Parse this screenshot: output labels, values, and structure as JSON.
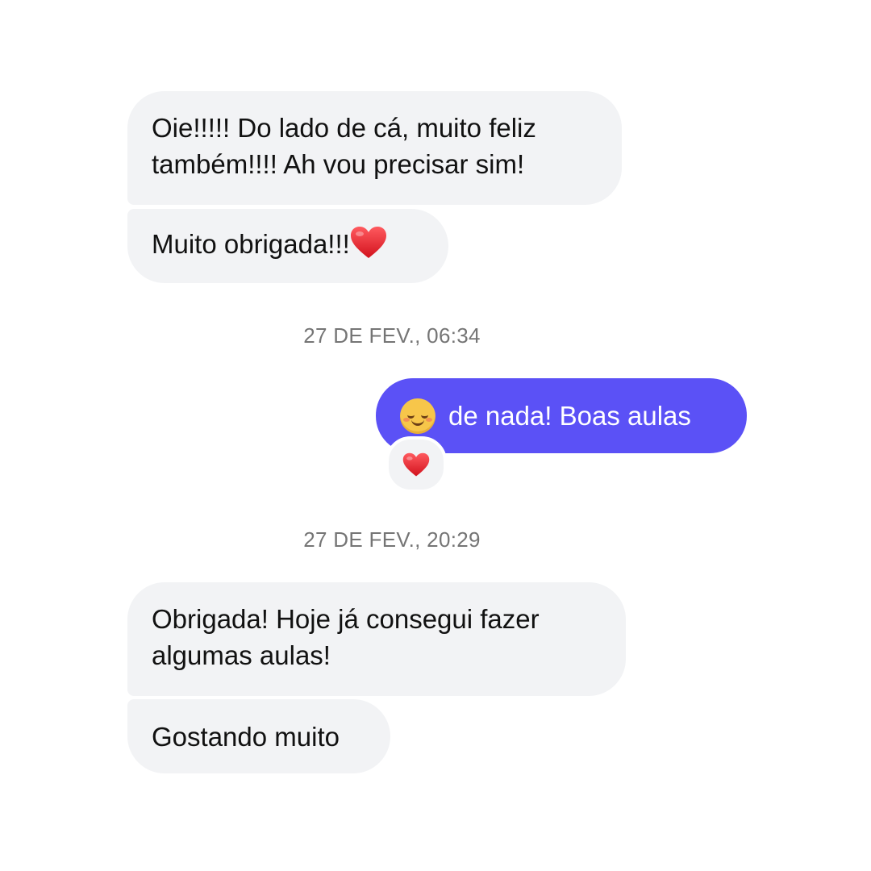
{
  "messages": {
    "m1": {
      "lines": [
        "Oie!!!!! Do lado de cá, muito feliz",
        "também!!!! Ah vou precisar sim!"
      ]
    },
    "m2": {
      "text": "Muito obrigada!!!"
    },
    "ts1": "27 DE FEV., 06:34",
    "sent": {
      "text": "de nada! Boas aulas",
      "emoji": "smiling-face-icon"
    },
    "reaction": "red-heart-icon",
    "ts2": "27 DE FEV., 20:29",
    "m3": {
      "lines": [
        "Obrigada! Hoje já consegui fazer",
        "algumas aulas!"
      ]
    },
    "m4": {
      "text": "Gostando muito"
    }
  },
  "colors": {
    "received_bubble": "#f2f3f5",
    "sent_bubble": "#5b51f6",
    "timestamp": "#757575",
    "heart": "#e0242f"
  }
}
